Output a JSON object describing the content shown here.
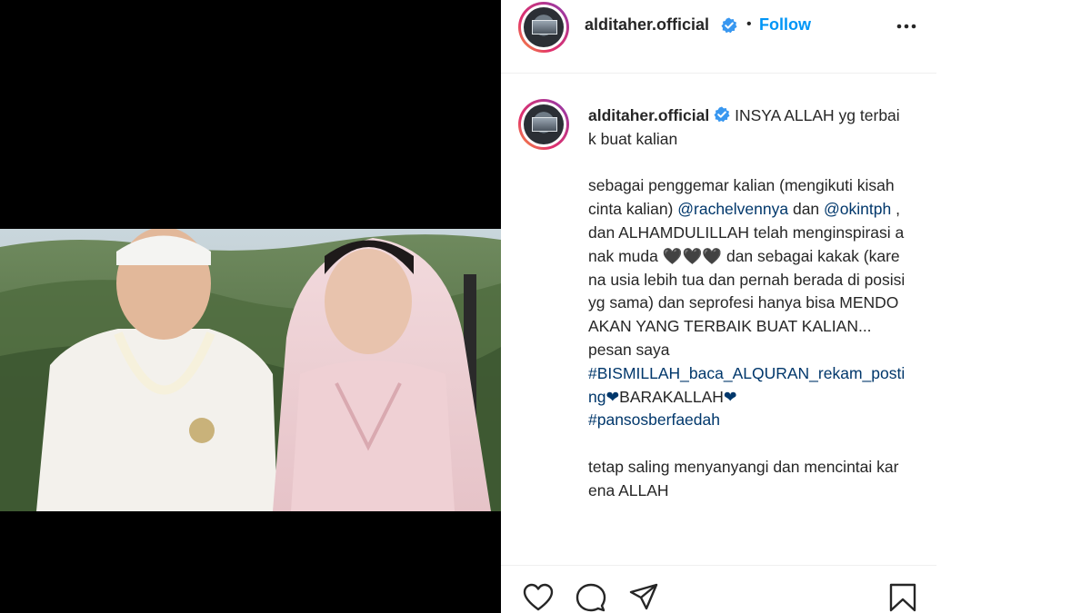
{
  "header": {
    "username": "alditaher.official",
    "dot": "•",
    "follow_label": "Follow"
  },
  "caption": {
    "username": "alditaher.official",
    "line1": " INSYA ALLAH yg terbaik buat kalian",
    "p2_a": "sebagai penggemar kalian (mengikuti kisah cinta kalian) ",
    "mention1": "@rachelvennya",
    "p2_b": " dan ",
    "mention2": "@okintph",
    "p2_c": " , dan ALHAMDULILLAH telah menginspirasi anak muda ",
    "hearts_black": "🖤🖤🖤",
    "p2_d": " dan sebagai kakak (karena usia lebih tua dan pernah berada di posisi yg sama) dan seprofesi hanya bisa MENDOAKAN YANG TERBAIK BUAT KALIAN...",
    "p3_a": "pesan saya",
    "hashtag1": "#BISMILLAH_baca_ALQURAN_rekam_posting",
    "heart_navy1": "❤",
    "p3_b": "BARAKALLAH",
    "heart_navy2": "❤",
    "hashtag2": "#pansosberfaedah",
    "p4": "tetap saling menyanyangi dan mencintai karena ALLAH"
  },
  "icons": {
    "verified": "verified-badge-icon",
    "more": "more-options-icon",
    "like": "heart-icon",
    "comment": "comment-icon",
    "share": "share-icon",
    "save": "bookmark-icon"
  },
  "colors": {
    "accent": "#0095f6",
    "link": "#00376b",
    "text": "#262626"
  }
}
